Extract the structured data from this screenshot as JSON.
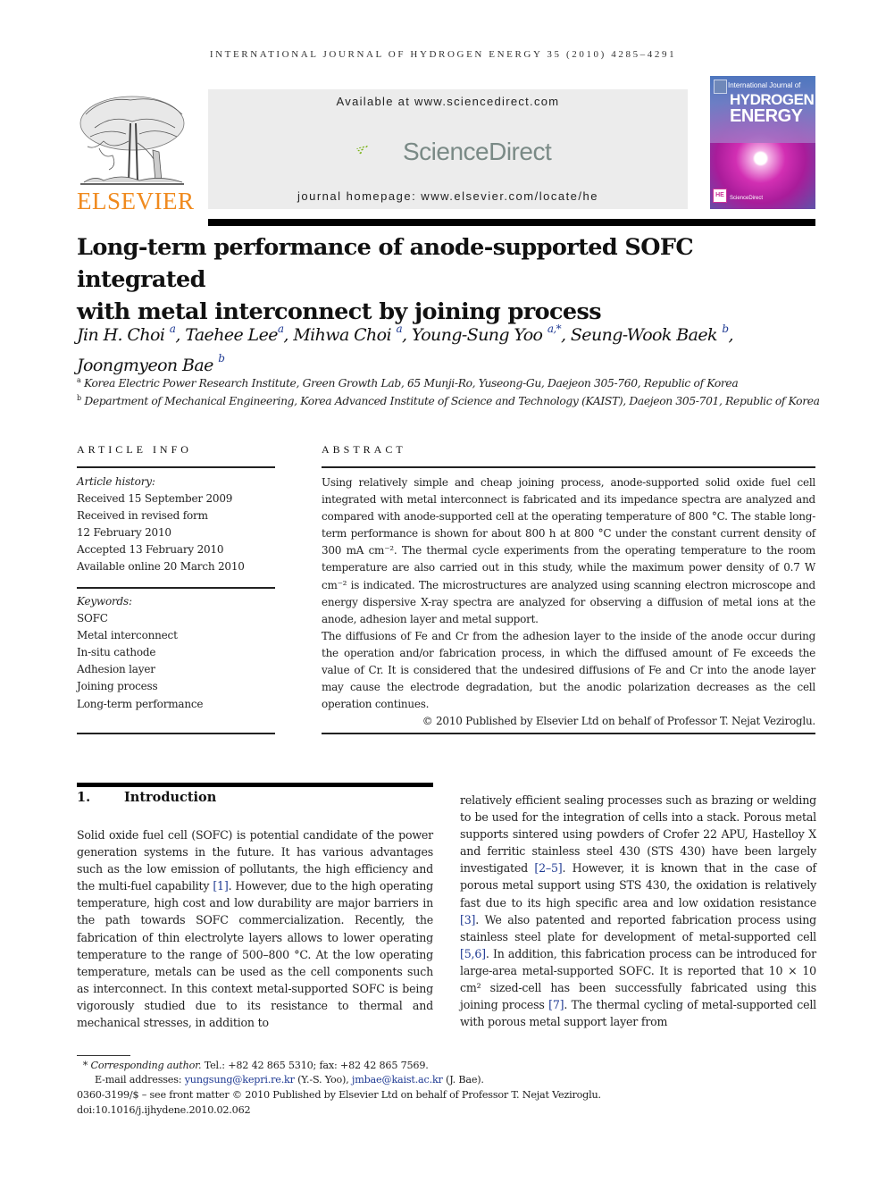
{
  "journal": {
    "running_head": "INTERNATIONAL JOURNAL OF HYDROGEN ENERGY 35 (2010) 4285–4291",
    "publisher_logo_text": "ELSEVIER",
    "available_at": "Available at www.sciencedirect.com",
    "sciencedirect_logo_text": "ScienceDirect",
    "homepage": "journal homepage: www.elsevier.com/locate/he",
    "cover": {
      "line1": "International Journal of",
      "line2": "HYDROGEN",
      "line3": "ENERGY",
      "badge": "HE",
      "footer": "ScienceDirect"
    },
    "colors": {
      "elsevier_orange": "#f08a1e",
      "link_blue": "#1f3a93",
      "sd_green": "#7ab317"
    }
  },
  "article": {
    "title_line1": "Long-term performance of anode-supported SOFC integrated",
    "title_line2": "with metal interconnect by joining process",
    "authors": [
      {
        "name": "Jin H. Choi",
        "sup": "a",
        "sep": ", "
      },
      {
        "name": "Taehee Lee",
        "sup": "a",
        "sep": ", "
      },
      {
        "name": "Mihwa Choi",
        "sup": "a",
        "sep": ", "
      },
      {
        "name": "Young-Sung Yoo",
        "sup": "a,*",
        "sep": ", "
      },
      {
        "name": "Seung-Wook Baek",
        "sup": "b",
        "sep": ","
      },
      {
        "name": "Joongmyeon Bae",
        "sup": "b",
        "sep": ""
      }
    ],
    "affiliations": [
      {
        "mark": "a",
        "text": "Korea Electric Power Research Institute, Green Growth Lab, 65 Munji-Ro, Yuseong-Gu, Daejeon 305-760, Republic of Korea"
      },
      {
        "mark": "b",
        "text": "Department of Mechanical Engineering, Korea Advanced Institute of Science and Technology (KAIST), Daejeon 305-701, Republic of Korea"
      }
    ]
  },
  "article_info": {
    "heading": "ARTICLE INFO",
    "history_label": "Article history:",
    "history": [
      "Received 15 September 2009",
      "Received in revised form",
      "12 February 2010",
      "Accepted 13 February 2010",
      "Available online 20 March 2010"
    ],
    "keywords_label": "Keywords:",
    "keywords": [
      "SOFC",
      "Metal interconnect",
      "In-situ cathode",
      "Adhesion layer",
      "Joining process",
      "Long-term performance"
    ]
  },
  "abstract": {
    "heading": "ABSTRACT",
    "paragraph1": "Using relatively simple and cheap joining process, anode-supported solid oxide fuel cell integrated with metal interconnect is fabricated and its impedance spectra are analyzed and compared with anode-supported cell at the operating temperature of 800 °C. The stable long-term performance is shown for about 800 h at 800 °C under the constant current density of 300 mA cm⁻². The thermal cycle experiments from the operating temperature to the room temperature are also carried out in this study, while the maximum power density of 0.7 W cm⁻² is indicated. The microstructures are analyzed using scanning electron microscope and energy dispersive X-ray spectra are analyzed for observing a diffusion of metal ions at the anode, adhesion layer and metal support.",
    "paragraph2": "The diffusions of Fe and Cr from the adhesion layer to the inside of the anode occur during the operation and/or fabrication process, in which the diffused amount of Fe exceeds the value of Cr. It is considered that the undesired diffusions of Fe and Cr into the anode layer may cause the electrode degradation, but the anodic polarization decreases as the cell operation continues.",
    "copyright": "© 2010 Published by Elsevier Ltd on behalf of Professor T. Nejat Veziroglu."
  },
  "introduction": {
    "number": "1.",
    "heading": "Introduction",
    "col1": [
      {
        "t": "Solid oxide fuel cell (SOFC) is potential candidate of the power generation systems in the future. It has various advantages such as the low emission of pollutants, the high efficiency and the multi-fuel capability "
      },
      {
        "t": "[1]",
        "ref": true
      },
      {
        "t": ". However, due to the high operating temperature, high cost and low durability are major barriers in the path towards SOFC commercialization. Recently, the fabrication of thin electrolyte layers allows to lower operating temperature to the range of 500–800 °C. At the low operating temperature, metals can be used as the cell components such as interconnect. In this context metal-supported SOFC is being vigorously studied due to its resistance to thermal and mechanical stresses, in addition to"
      }
    ],
    "col2": [
      {
        "t": "relatively efficient sealing processes such as brazing or welding to be used for the integration of cells into a stack. Porous metal supports sintered using powders of Crofer 22 APU, Hastelloy X and ferritic stainless steel 430 (STS 430) have been largely investigated "
      },
      {
        "t": "[2–5]",
        "ref": true
      },
      {
        "t": ". However, it is known that in the case of porous metal support using STS 430, the oxidation is relatively fast due to its high specific area and low oxidation resistance "
      },
      {
        "t": "[3]",
        "ref": true
      },
      {
        "t": ". We also patented and reported fabrication process using stainless steel plate for development of metal-supported cell "
      },
      {
        "t": "[5,6]",
        "ref": true
      },
      {
        "t": ". In addition, this fabrication process can be introduced for large-area metal-supported SOFC. It is reported that 10 × 10 cm² sized-cell has been successfully fabricated using this joining process "
      },
      {
        "t": "[7]",
        "ref": true
      },
      {
        "t": ". The thermal cycling of metal-supported cell with porous metal support layer from"
      }
    ]
  },
  "footnotes": {
    "corresponding_mark": "*",
    "corresponding_label": "Corresponding author.",
    "contact": " Tel.: +82 42 865 5310; fax: +82 42 865 7569.",
    "email_label": "E-mail addresses: ",
    "email1": "yungsung@kepri.re.kr",
    "email1_owner": " (Y.-S. Yoo), ",
    "email2": "jmbae@kaist.ac.kr",
    "email2_owner": " (J. Bae).",
    "issn_line": "0360-3199/$ – see front matter © 2010 Published by Elsevier Ltd on behalf of Professor T. Nejat Veziroglu.",
    "doi": "doi:10.1016/j.ijhydene.2010.02.062"
  }
}
